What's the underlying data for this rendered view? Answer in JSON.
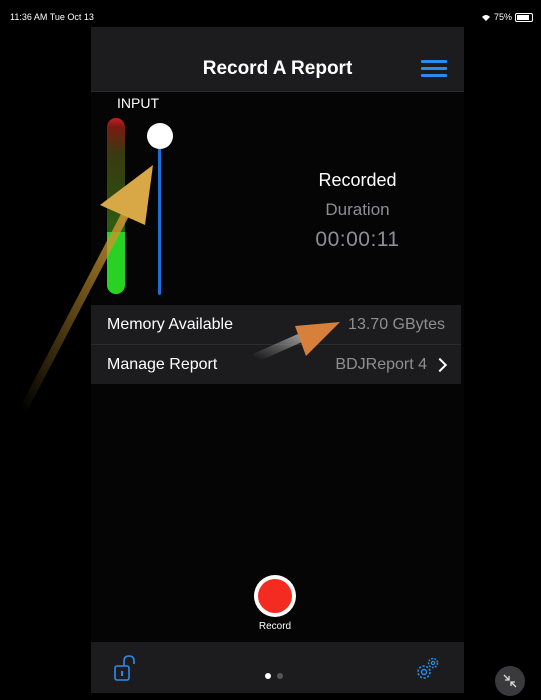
{
  "status_bar": {
    "time": "11:36 AM  Tue Oct 13",
    "battery": "75%"
  },
  "header": {
    "title": "Record A Report",
    "menu_icon": "hamburger-menu-icon"
  },
  "input": {
    "label": "INPUT",
    "meter_level": 0.35,
    "slider_level": 1.0
  },
  "recording": {
    "recorded_label": "Recorded",
    "duration_label": "Duration",
    "duration_value": "00:00:11"
  },
  "rows": {
    "memory": {
      "label": "Memory Available",
      "value": "13.70 GBytes"
    },
    "manage": {
      "label": "Manage Report",
      "value": "BDJReport 4"
    }
  },
  "record_button": {
    "label": "Record"
  },
  "tabbar": {
    "pages": 2,
    "current_page": 1
  },
  "colors": {
    "accent": "#2a8cf0",
    "record_red": "#f42b20",
    "meter_green": "#27d224"
  }
}
